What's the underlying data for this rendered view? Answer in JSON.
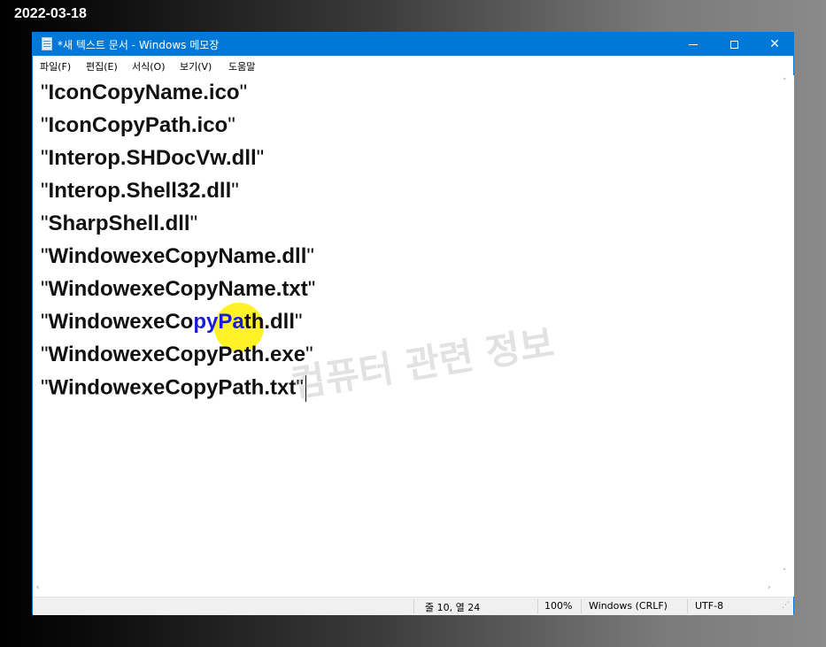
{
  "date_stamp": "2022-03-18",
  "window": {
    "title": "*새 텍스트 문서 - Windows 메모장",
    "controls": {
      "minimize": "—",
      "maximize": "☐",
      "close": "✕"
    }
  },
  "menu": [
    "파일(F)",
    "편집(E)",
    "서식(O)",
    "보기(V)",
    "도움말"
  ],
  "editor": {
    "lines": [
      "IconCopyName.ico",
      "IconCopyPath.ico",
      "Interop.SHDocVw.dll",
      "Interop.Shell32.dll",
      "SharpShell.dll",
      "WindowexeCopyName.dll",
      "WindowexeCopyName.txt",
      "WindowexeCopyPath.dll",
      "WindowexeCopyPath.exe",
      "WindowexeCopyPath.txt"
    ],
    "selected_line": {
      "before": "WindowexeCo",
      "selected": "pyPa",
      "after": "th.dll"
    },
    "watermark": "컴퓨터 관련 정보",
    "quote": "\""
  },
  "status": {
    "position": "줄 10, 열 24",
    "zoom": "100%",
    "line_ending": "Windows (CRLF)",
    "encoding": "UTF-8"
  },
  "icons": {
    "up": "˄",
    "down": "˅",
    "left": "‹",
    "right": "›",
    "grip": "⋰"
  },
  "colors": {
    "title_bar": "#0078d7",
    "highlight": "#fff000",
    "selection_text": "#1a1adb"
  }
}
